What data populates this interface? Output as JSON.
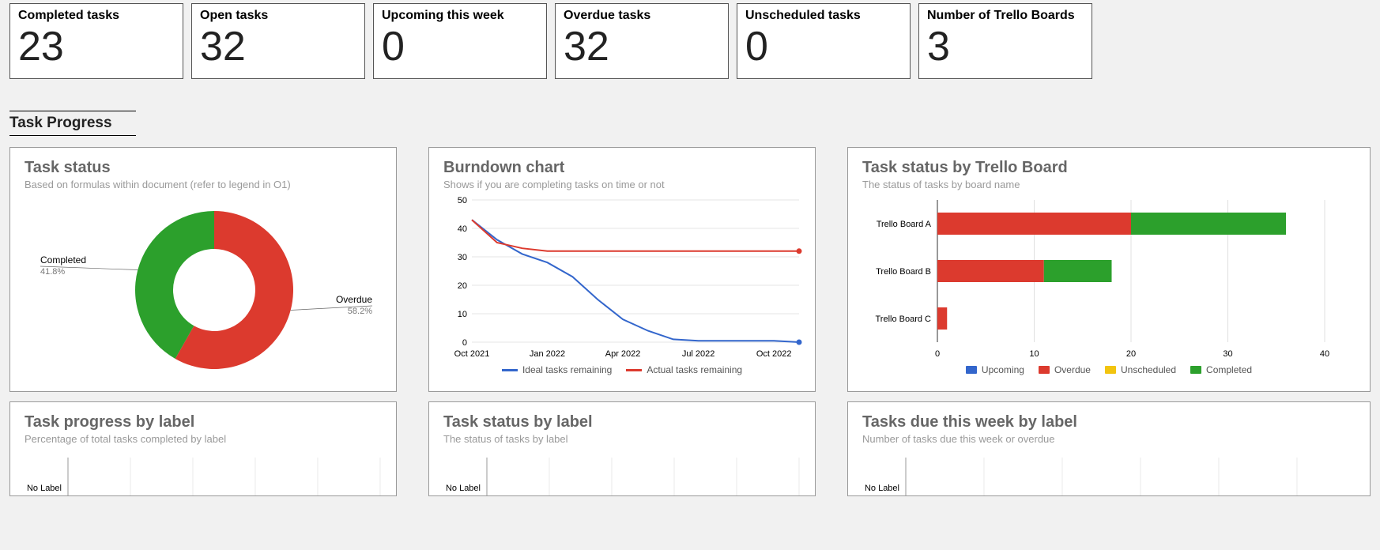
{
  "kpis": [
    {
      "label": "Completed tasks",
      "value": "23"
    },
    {
      "label": "Open tasks",
      "value": "32"
    },
    {
      "label": "Upcoming this week",
      "value": "0"
    },
    {
      "label": "Overdue tasks",
      "value": "32"
    },
    {
      "label": "Unscheduled tasks",
      "value": "0"
    },
    {
      "label": "Number of Trello Boards",
      "value": "3"
    }
  ],
  "section_title": "Task Progress",
  "colors": {
    "blue": "#3366cc",
    "red": "#dc3a2e",
    "green": "#2ca02c",
    "yellow": "#f2c40f"
  },
  "donut": {
    "title": "Task status",
    "subtitle": "Based on formulas within document (refer to legend in O1)",
    "slices": [
      {
        "label": "Completed",
        "pct": 41.8,
        "color": "#2ca02c"
      },
      {
        "label": "Overdue",
        "pct": 58.2,
        "color": "#dc3a2e"
      }
    ]
  },
  "burndown": {
    "title": "Burndown chart",
    "subtitle": "Shows if you are completing tasks on time or not",
    "legend": {
      "ideal": "Ideal tasks remaining",
      "actual": "Actual tasks remaining"
    }
  },
  "by_board": {
    "title": "Task status by Trello Board",
    "subtitle": "The status of tasks by board name",
    "legend": {
      "upcoming": "Upcoming",
      "overdue": "Overdue",
      "unscheduled": "Unscheduled",
      "completed": "Completed"
    }
  },
  "progress_by_label": {
    "title": "Task progress by label",
    "subtitle": "Percentage of total tasks completed by label",
    "row0": "No Label"
  },
  "status_by_label": {
    "title": "Task status by label",
    "subtitle": "The status of tasks by label",
    "row0": "No Label"
  },
  "due_by_label": {
    "title": "Tasks due this week by label",
    "subtitle": "Number of tasks due this week or overdue",
    "row0": "No Label"
  },
  "chart_data": [
    {
      "type": "pie",
      "title": "Task status",
      "series": [
        {
          "name": "Completed",
          "value": 41.8
        },
        {
          "name": "Overdue",
          "value": 58.2
        }
      ]
    },
    {
      "type": "line",
      "title": "Burndown chart",
      "xlabel": "",
      "ylabel": "",
      "ylim": [
        0,
        50
      ],
      "x_ticks": [
        "Oct 2021",
        "Jan 2022",
        "Apr 2022",
        "Jul 2022",
        "Oct 2022"
      ],
      "series": [
        {
          "name": "Ideal tasks remaining",
          "color": "#3366cc",
          "x": [
            "Oct 2021",
            "Nov 2021",
            "Dec 2021",
            "Jan 2022",
            "Feb 2022",
            "Mar 2022",
            "Apr 2022",
            "May 2022",
            "Jun 2022",
            "Jul 2022",
            "Aug 2022",
            "Sep 2022",
            "Oct 2022",
            "Nov 2022"
          ],
          "values": [
            43,
            36,
            31,
            28,
            23,
            15,
            8,
            4,
            1,
            0.5,
            0.5,
            0.5,
            0.5,
            0
          ]
        },
        {
          "name": "Actual tasks remaining",
          "color": "#dc3a2e",
          "x": [
            "Oct 2021",
            "Nov 2021",
            "Dec 2021",
            "Jan 2022",
            "Feb 2022",
            "Mar 2022",
            "Apr 2022",
            "May 2022",
            "Jun 2022",
            "Jul 2022",
            "Aug 2022",
            "Sep 2022",
            "Oct 2022",
            "Nov 2022"
          ],
          "values": [
            43,
            35,
            33,
            32,
            32,
            32,
            32,
            32,
            32,
            32,
            32,
            32,
            32,
            32
          ]
        }
      ]
    },
    {
      "type": "bar",
      "orientation": "horizontal",
      "stacked": true,
      "title": "Task status by Trello Board",
      "xlim": [
        0,
        40
      ],
      "categories": [
        "Trello Board A",
        "Trello Board B",
        "Trello Board C"
      ],
      "series": [
        {
          "name": "Upcoming",
          "color": "#3366cc",
          "values": [
            0,
            0,
            0
          ]
        },
        {
          "name": "Overdue",
          "color": "#dc3a2e",
          "values": [
            20,
            11,
            1
          ]
        },
        {
          "name": "Unscheduled",
          "color": "#f2c40f",
          "values": [
            0,
            0,
            0
          ]
        },
        {
          "name": "Completed",
          "color": "#2ca02c",
          "values": [
            16,
            7,
            0
          ]
        }
      ]
    }
  ]
}
